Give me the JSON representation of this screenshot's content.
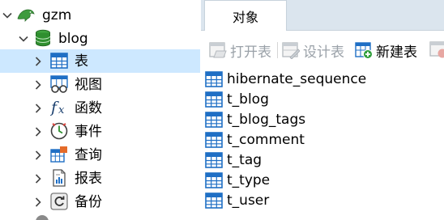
{
  "tree": {
    "connection": {
      "label": "gzm",
      "icon": "dolphin-connection-icon"
    },
    "database": {
      "label": "blog",
      "icon": "database-icon"
    },
    "items": [
      {
        "label": "表",
        "icon": "table-grid-icon",
        "selected": true
      },
      {
        "label": "视图",
        "icon": "view-glasses-icon",
        "selected": false
      },
      {
        "label": "函数",
        "icon": "function-fx-icon",
        "selected": false
      },
      {
        "label": "事件",
        "icon": "event-clock-icon",
        "selected": false
      },
      {
        "label": "查询",
        "icon": "query-table-icon",
        "selected": false
      },
      {
        "label": "报表",
        "icon": "report-document-icon",
        "selected": false
      },
      {
        "label": "备份",
        "icon": "backup-restore-icon",
        "selected": false
      }
    ]
  },
  "tabs": [
    {
      "label": "对象",
      "active": true
    }
  ],
  "toolbar": {
    "open_table": "打开表",
    "design_table": "设计表",
    "new_table": "新建表"
  },
  "objects": [
    "hibernate_sequence",
    "t_blog",
    "t_blog_tags",
    "t_comment",
    "t_tag",
    "t_type",
    "t_user"
  ],
  "colors": {
    "selection": "#cde8ff",
    "tab_strip": "#dbe5ee",
    "table_icon_blue": "#1f6fc5",
    "database_green": "#2f8f2f",
    "disabled_text": "#9aa1a8"
  }
}
